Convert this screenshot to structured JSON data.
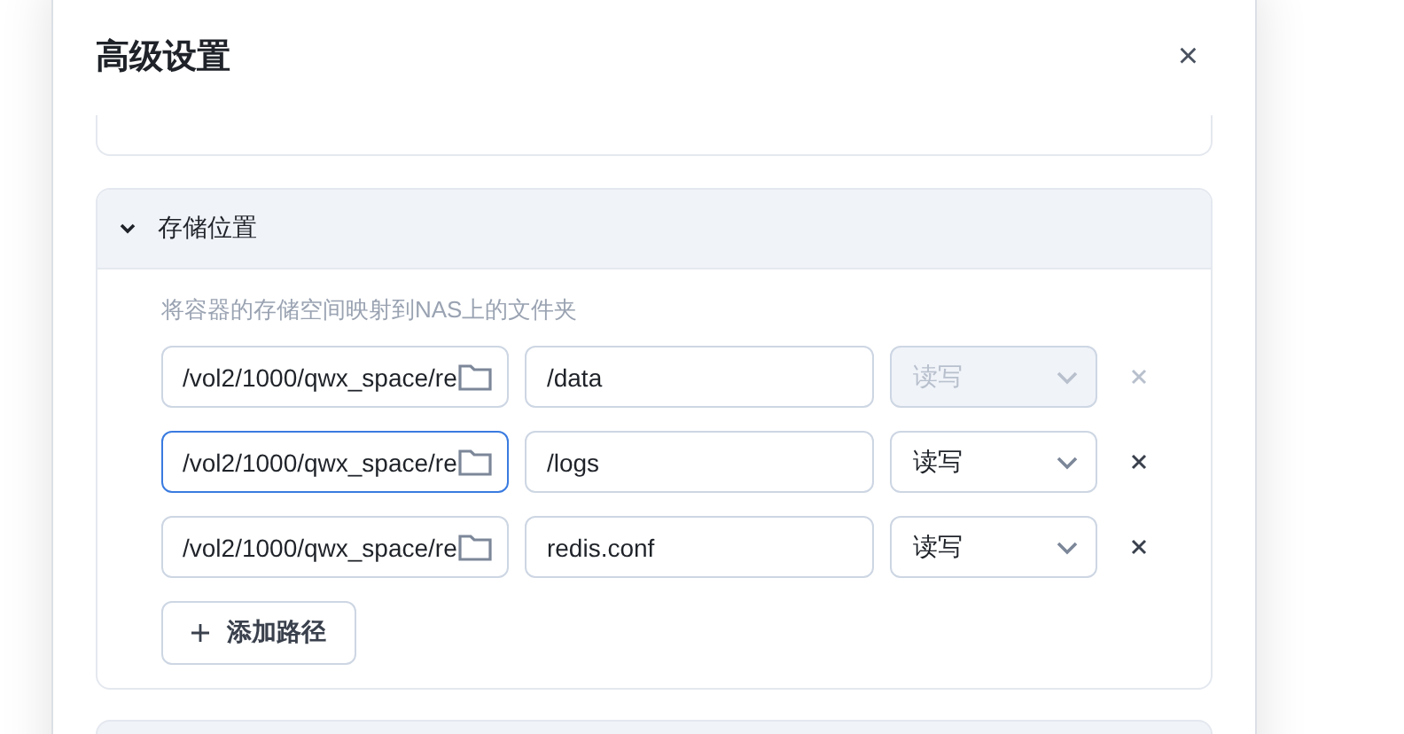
{
  "dialog": {
    "title": "高级设置",
    "close": "×"
  },
  "section": {
    "title": "存储位置",
    "expanded": true,
    "description": "将容器的存储空间映射到NAS上的文件夹",
    "mounts": [
      {
        "host_path": "/vol2/1000/qwx_space/re",
        "focused": false,
        "container_path": "/data",
        "mode": "读写",
        "disabled": true
      },
      {
        "host_path": "/vol2/1000/qwx_space/re",
        "focused": true,
        "container_path": "/logs",
        "mode": "读写",
        "disabled": false
      },
      {
        "host_path": "/vol2/1000/qwx_space/re",
        "focused": false,
        "container_path": "redis.conf",
        "mode": "读写",
        "disabled": false
      }
    ],
    "add_button": "添加路径"
  }
}
